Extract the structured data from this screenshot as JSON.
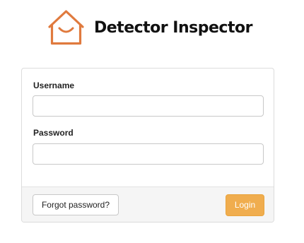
{
  "brand": {
    "name": "Detector Inspector",
    "logo_icon": "house-smile-icon",
    "logo_color": "#e07a3e"
  },
  "login_form": {
    "username_label": "Username",
    "username_value": "",
    "password_label": "Password",
    "password_value": "",
    "forgot_password_label": "Forgot password?",
    "login_label": "Login",
    "login_button_color": "#f0ad4e"
  }
}
